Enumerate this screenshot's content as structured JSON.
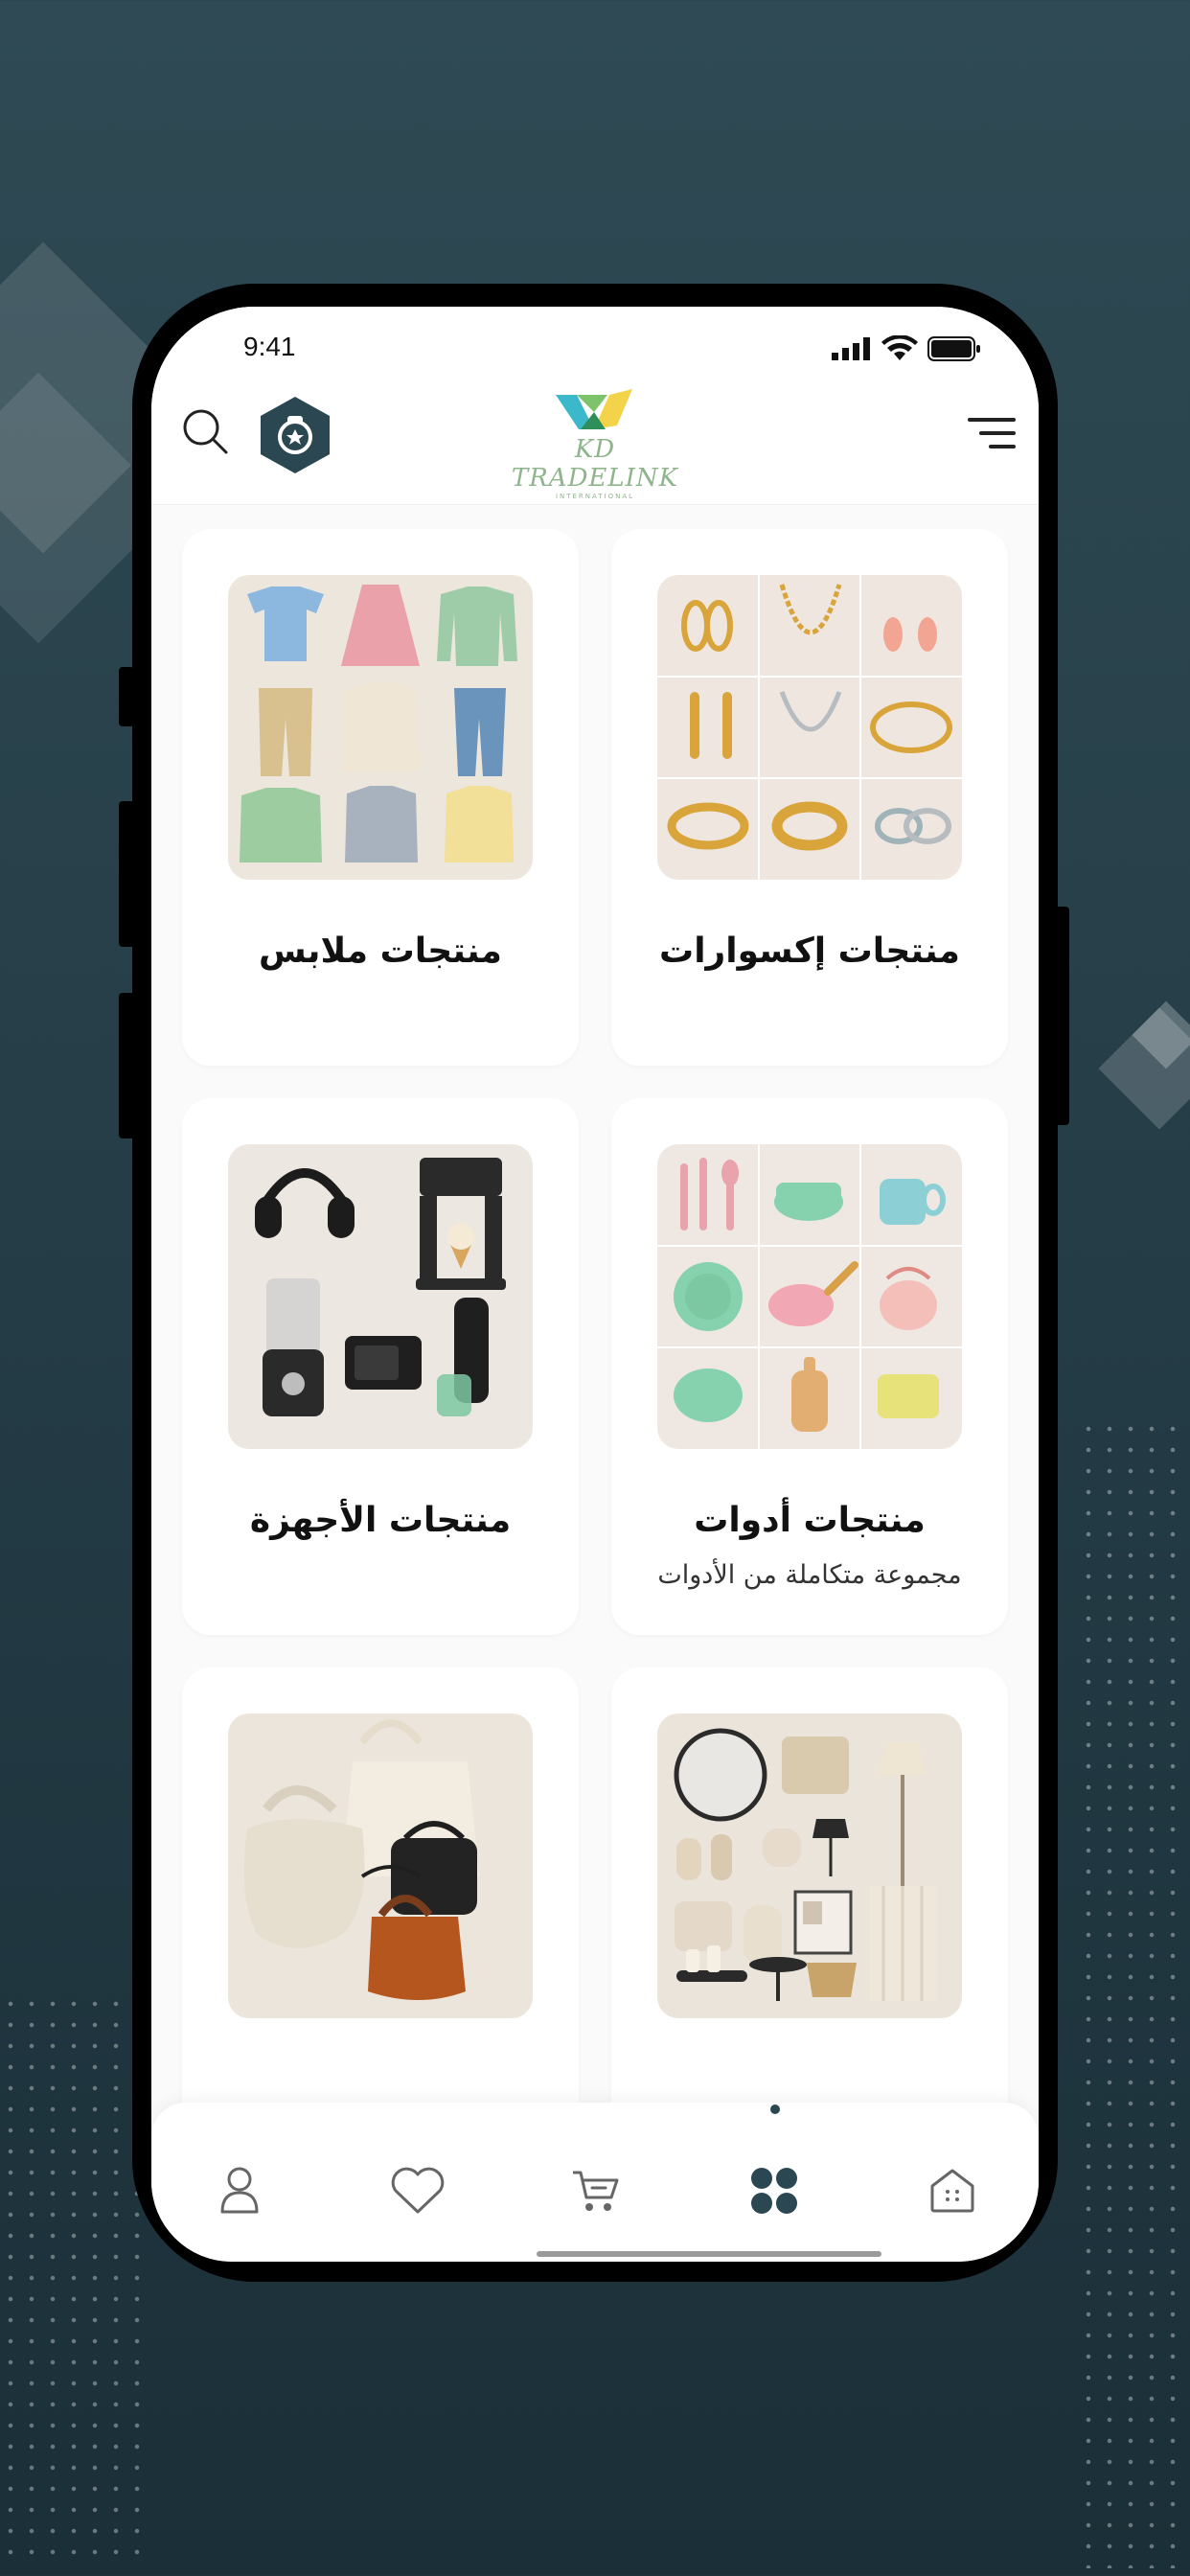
{
  "status_bar": {
    "time": "9:41"
  },
  "header": {
    "brand": "KD TRADELINK",
    "brand_sub": "INTERNATIONAL",
    "search_icon": "search-icon",
    "badge_icon": "star-badge-icon",
    "menu_icon": "menu-icon"
  },
  "categories": [
    {
      "title": "منتجات إكسوارات",
      "subtitle": "",
      "image": "jewelry-image"
    },
    {
      "title": "منتجات ملابس",
      "subtitle": "",
      "image": "clothes-image"
    },
    {
      "title": "منتجات أدوات",
      "subtitle": "مجموعة متكاملة من الأدوات",
      "image": "kitchenware-image"
    },
    {
      "title": "منتجات الأجهزة",
      "subtitle": "",
      "image": "appliances-image"
    },
    {
      "title": "",
      "subtitle": "",
      "image": "home-decor-image"
    },
    {
      "title": "",
      "subtitle": "",
      "image": "bags-image"
    }
  ],
  "bottom_nav": {
    "items": [
      "profile-icon",
      "heart-icon",
      "cart-icon",
      "categories-icon",
      "home-icon"
    ],
    "active": "categories-icon"
  },
  "colors": {
    "background": "#243c46",
    "accent": "#2b4752",
    "card": "#ffffff",
    "screen": "#fafafa"
  }
}
